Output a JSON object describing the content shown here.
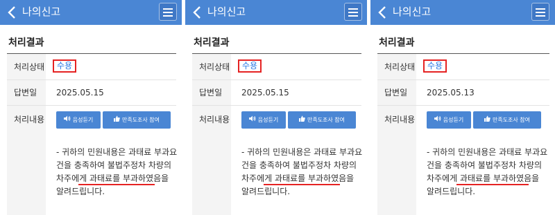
{
  "header": {
    "title": "나의신고"
  },
  "section": {
    "title": "처리결과"
  },
  "labels": {
    "status": "처리상태",
    "answer_date": "답변일",
    "content": "처리내용"
  },
  "buttons": {
    "audio": "음성듣기",
    "survey": "만족도조사 참여"
  },
  "panels": [
    {
      "status": "수용",
      "answer_date": "2025.05.15",
      "content_lines": [
        "- 귀하의 민원내용은 과태료 부과요",
        "건을 충족하여 불법주정차 차량의",
        "차주에게 과태료를 부과하였음을",
        "알려드립니다."
      ]
    },
    {
      "status": "수용",
      "answer_date": "2025.05.15",
      "content_lines": [
        "- 귀하의 민원내용은 과태료 부과요",
        "건을 충족하여 불법주정차 차량의",
        "차주에게 과태료를 부과하였음을",
        "알려드립니다."
      ]
    },
    {
      "status": "수용",
      "answer_date": "2025.05.13",
      "content_lines": [
        "- 귀하의 민원내용은 과태료 부과요",
        "건을 충족하여 불법주정차 차량의",
        "차주에게 과태료를 부과하였음을",
        "알려드립니다."
      ]
    }
  ],
  "colors": {
    "topbar": "#4a86d4",
    "highlight": "#e52222",
    "status_text": "#2c7be5"
  },
  "icons": {
    "back": "chevron-left-icon",
    "menu": "hamburger-menu-icon",
    "audio": "speaker-icon",
    "survey": "thumbs-up-icon"
  }
}
